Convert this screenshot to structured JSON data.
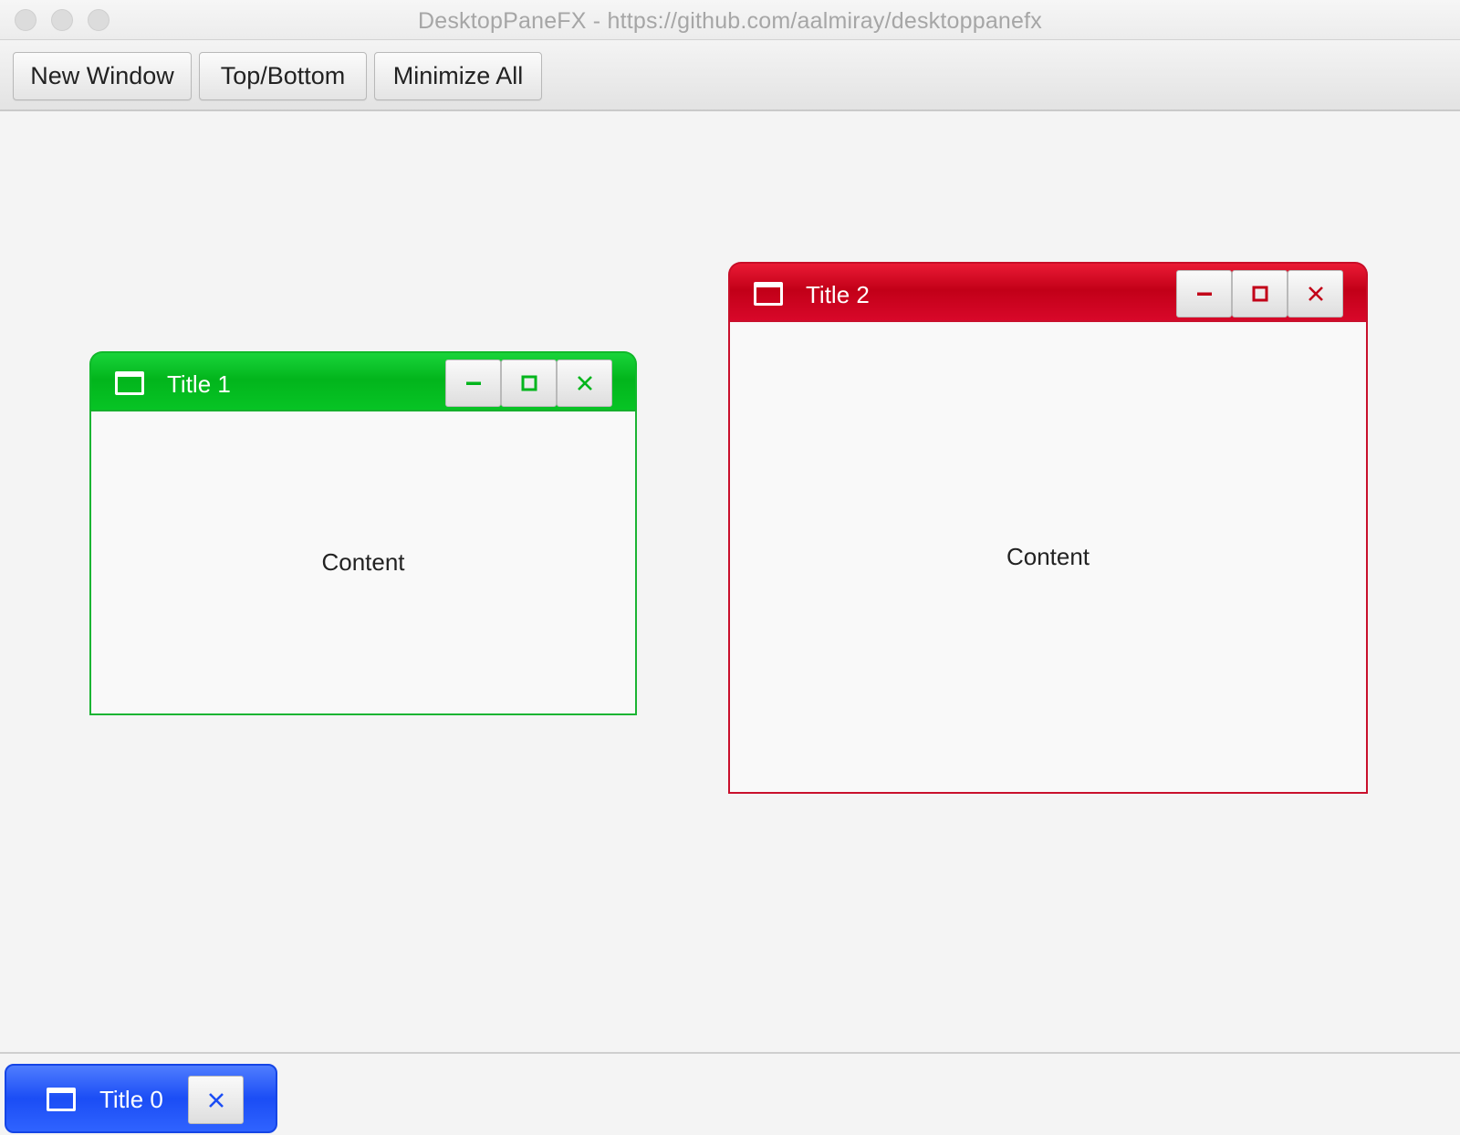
{
  "app": {
    "window_title": "DesktopPaneFX - https://github.com/aalmiray/desktoppanefx"
  },
  "toolbar": {
    "buttons": [
      {
        "label": "New Window"
      },
      {
        "label": "Top/Bottom"
      },
      {
        "label": "Minimize All"
      }
    ]
  },
  "windows": [
    {
      "title": "Title 1",
      "content": "Content",
      "accent": "#02b51c",
      "icon": "window-icon",
      "controls": [
        "minimize-icon",
        "maximize-icon",
        "close-icon"
      ]
    },
    {
      "title": "Title 2",
      "content": "Content",
      "accent": "#c20018",
      "icon": "window-icon",
      "controls": [
        "minimize-icon",
        "maximize-icon",
        "close-icon"
      ]
    }
  ],
  "dock": {
    "items": [
      {
        "title": "Title 0",
        "accent": "#1b4df5",
        "icon": "window-icon",
        "controls": [
          "close-icon"
        ]
      }
    ]
  }
}
